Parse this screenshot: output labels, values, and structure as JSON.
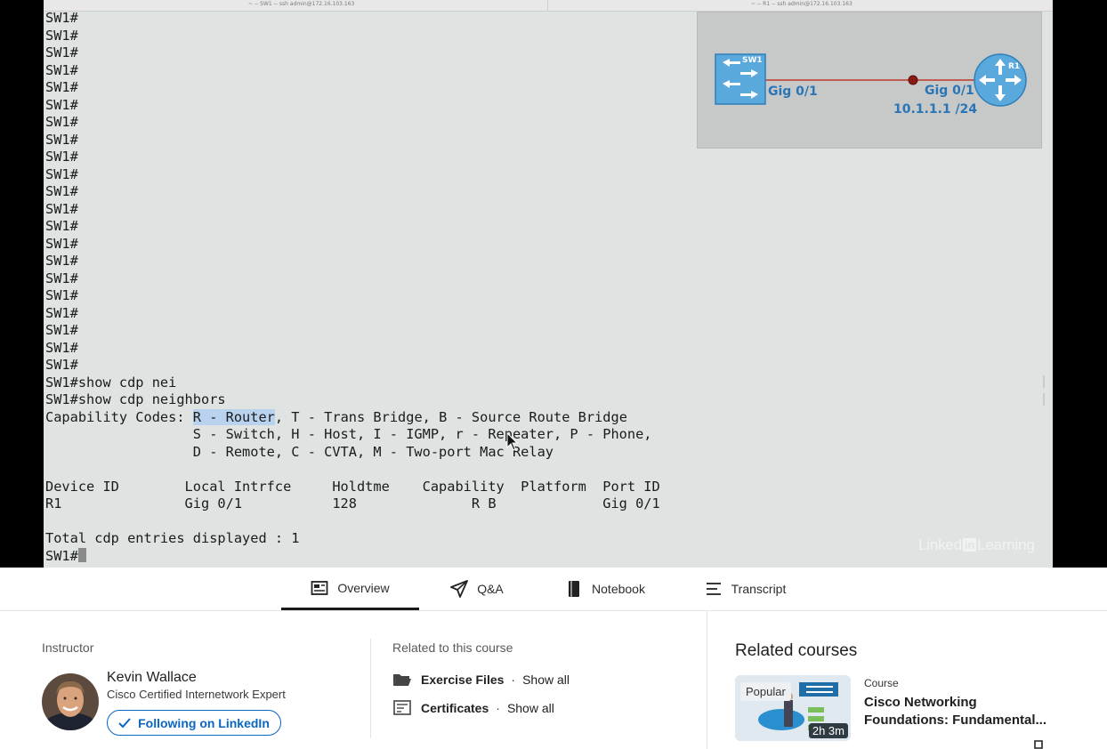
{
  "video": {
    "left_window_title": "~ -- SW1 -- ssh admin@172.16.103.163",
    "right_window_title": "~ -- R1 -- ssh admin@172.16.103.163",
    "terminal_lines": [
      "SW1#",
      "SW1#",
      "SW1#",
      "SW1#",
      "SW1#",
      "SW1#",
      "SW1#",
      "SW1#",
      "SW1#",
      "SW1#",
      "SW1#",
      "SW1#",
      "SW1#",
      "SW1#",
      "SW1#",
      "SW1#",
      "SW1#",
      "SW1#",
      "SW1#",
      "SW1#",
      "SW1#",
      "SW1#show cdp nei",
      "SW1#show cdp neighbors"
    ],
    "capability_prefix": "Capability Codes: ",
    "capability_highlight": "R - Router",
    "capability_rest": ", T - Trans Bridge, B - Source Route Bridge",
    "capability_line2": "                  S - Switch, H - Host, I - IGMP, r - Repeater, P - Phone,",
    "capability_line3": "                  D - Remote, C - CVTA, M - Two-port Mac Relay",
    "blank": "",
    "table_header": "Device ID        Local Intrfce     Holdtme    Capability  Platform  Port ID",
    "table_row": "R1               Gig 0/1           128              R B             Gig 0/1",
    "total_line": "Total cdp entries displayed : 1",
    "final_prompt": "SW1#",
    "topology": {
      "switch_name": "SW1",
      "router_name": "R1",
      "switch_port": "Gig 0/1",
      "router_port": "Gig 0/1",
      "router_ip": "10.1.1.1 /24",
      "link_color": "#c0392b",
      "device_color": "#5aa9dd"
    },
    "watermark_left": "Linked",
    "watermark_in": "in",
    "watermark_right": "Learning"
  },
  "tabs": [
    {
      "label": "Overview",
      "icon": "overview-icon",
      "active": true
    },
    {
      "label": "Q&A",
      "icon": "paper-plane-icon",
      "active": false
    },
    {
      "label": "Notebook",
      "icon": "notebook-icon",
      "active": false
    },
    {
      "label": "Transcript",
      "icon": "transcript-icon",
      "active": false
    }
  ],
  "instructor": {
    "section_label": "Instructor",
    "name": "Kevin Wallace",
    "title": "Cisco Certified Internetwork Expert",
    "follow_label": "Following on LinkedIn"
  },
  "related": {
    "section_label": "Related to this course",
    "items": [
      {
        "label": "Exercise Files",
        "link": "Show all",
        "icon": "folder-icon"
      },
      {
        "label": "Certificates",
        "link": "Show all",
        "icon": "certificate-icon"
      }
    ]
  },
  "related_courses": {
    "title": "Related courses",
    "course": {
      "badge": "Popular",
      "duration": "2h 3m",
      "kind": "Course",
      "name": "Cisco Networking Foundations: Fundamental..."
    }
  },
  "colors": {
    "accent": "#0a66c2",
    "terminal_bg": "#dfe4e3",
    "highlight": "#b9d3ee"
  }
}
